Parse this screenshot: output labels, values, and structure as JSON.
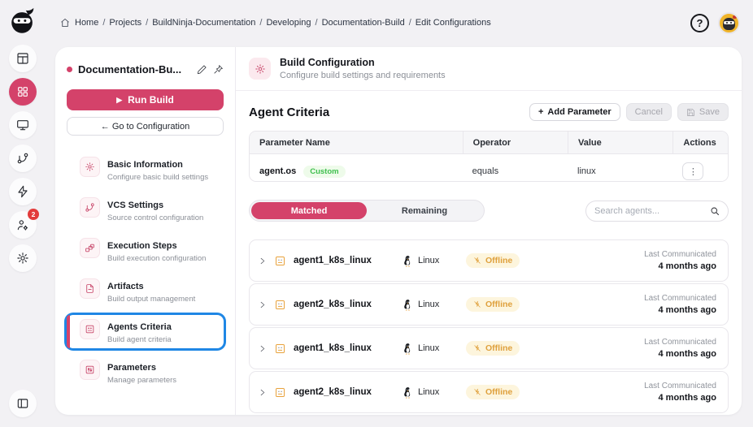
{
  "colors": {
    "accent": "#d4426a",
    "focus_ring": "#1f87e5",
    "offline": "#dfa03c",
    "custom_green": "#3fbf4e"
  },
  "icons": {
    "help": "?",
    "dots": "⋮",
    "plus": "+",
    "play": "▶"
  },
  "topbar": {
    "separator": "/",
    "breadcrumb": [
      "Home",
      "Projects",
      "BuildNinja-Documentation",
      "Developing",
      "Documentation-Build",
      "Edit Configurations"
    ]
  },
  "rail": {
    "notification_count": "2"
  },
  "config_panel": {
    "title": "Documentation-Bu...",
    "run_label": "Run Build",
    "goto_label": "← Go to Configuration",
    "nav": [
      {
        "title": "Basic Information",
        "subtitle": "Configure basic build settings"
      },
      {
        "title": "VCS Settings",
        "subtitle": "Source control configuration"
      },
      {
        "title": "Execution Steps",
        "subtitle": "Build execution configuration"
      },
      {
        "title": "Artifacts",
        "subtitle": "Build output management"
      },
      {
        "title": "Agents Criteria",
        "subtitle": "Build agent criteria"
      },
      {
        "title": "Parameters",
        "subtitle": "Manage parameters"
      }
    ]
  },
  "main": {
    "header": {
      "title": "Build Configuration",
      "subtitle": "Configure build settings and requirements"
    },
    "section": {
      "title": "Agent Criteria",
      "add_label": "Add Parameter",
      "cancel_label": "Cancel",
      "save_label": "Save"
    },
    "table": {
      "headers": [
        "Parameter Name",
        "Operator",
        "Value",
        "Actions"
      ],
      "rows": [
        {
          "name": "agent.os",
          "badge": "Custom",
          "operator": "equals",
          "value": "linux"
        }
      ]
    },
    "tabs": {
      "matched": "Matched",
      "remaining": "Remaining"
    },
    "search_placeholder": "Search agents...",
    "agents": [
      {
        "name": "agent1_k8s_linux",
        "os": "Linux",
        "status": "Offline",
        "last_label": "Last Communicated",
        "last_value": "4 months ago"
      },
      {
        "name": "agent2_k8s_linux",
        "os": "Linux",
        "status": "Offline",
        "last_label": "Last Communicated",
        "last_value": "4 months ago"
      },
      {
        "name": "agent1_k8s_linux",
        "os": "Linux",
        "status": "Offline",
        "last_label": "Last Communicated",
        "last_value": "4 months ago"
      },
      {
        "name": "agent2_k8s_linux",
        "os": "Linux",
        "status": "Offline",
        "last_label": "Last Communicated",
        "last_value": "4 months ago"
      }
    ]
  }
}
